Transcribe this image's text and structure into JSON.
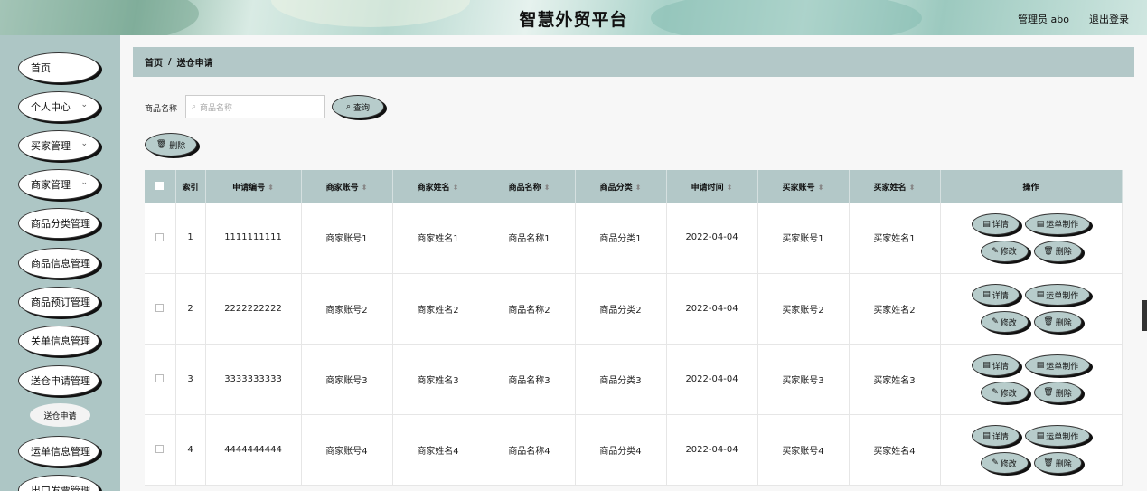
{
  "header": {
    "title": "智慧外贸平台",
    "user_label": "管理员 abo",
    "logout_label": "退出登录"
  },
  "sidebar": {
    "items": [
      {
        "label": "首页",
        "has_chevron": false
      },
      {
        "label": "个人中心",
        "has_chevron": true
      },
      {
        "label": "买家管理",
        "has_chevron": true
      },
      {
        "label": "商家管理",
        "has_chevron": true
      },
      {
        "label": "商品分类管理",
        "has_chevron": false
      },
      {
        "label": "商品信息管理",
        "has_chevron": false
      },
      {
        "label": "商品预订管理",
        "has_chevron": false
      },
      {
        "label": "关单信息管理",
        "has_chevron": false
      },
      {
        "label": "送仓申请管理",
        "has_chevron": false
      },
      {
        "label": "运单信息管理",
        "has_chevron": false
      },
      {
        "label": "出口发票管理",
        "has_chevron": false
      }
    ],
    "submenu": {
      "label": "送仓申请"
    }
  },
  "breadcrumb": {
    "home": "首页",
    "separator": "/",
    "current": "送仓申请"
  },
  "search": {
    "label": "商品名称",
    "placeholder": "商品名称",
    "query_button": "查询",
    "delete_button": "删除"
  },
  "table": {
    "headers": [
      "索引",
      "申请编号",
      "商家账号",
      "商家姓名",
      "商品名称",
      "商品分类",
      "申请时间",
      "买家账号",
      "买家姓名",
      "操作"
    ],
    "rows": [
      {
        "index": "1",
        "apply_no": "1111111111",
        "merchant_acct": "商家账号1",
        "merchant_name": "商家姓名1",
        "product_name": "商品名称1",
        "category": "商品分类1",
        "apply_time": "2022-04-04",
        "buyer_acct": "买家账号1",
        "buyer_name": "买家姓名1"
      },
      {
        "index": "2",
        "apply_no": "2222222222",
        "merchant_acct": "商家账号2",
        "merchant_name": "商家姓名2",
        "product_name": "商品名称2",
        "category": "商品分类2",
        "apply_time": "2022-04-04",
        "buyer_acct": "买家账号2",
        "buyer_name": "买家姓名2"
      },
      {
        "index": "3",
        "apply_no": "3333333333",
        "merchant_acct": "商家账号3",
        "merchant_name": "商家姓名3",
        "product_name": "商品名称3",
        "category": "商品分类3",
        "apply_time": "2022-04-04",
        "buyer_acct": "买家账号3",
        "buyer_name": "买家姓名3"
      },
      {
        "index": "4",
        "apply_no": "4444444444",
        "merchant_acct": "商家账号4",
        "merchant_name": "商家姓名4",
        "product_name": "商品名称4",
        "category": "商品分类4",
        "apply_time": "2022-04-04",
        "buyer_acct": "买家账号4",
        "buyer_name": "买家姓名4"
      }
    ],
    "actions": {
      "detail": "详情",
      "waybill": "运单制作",
      "edit": "修改",
      "delete": "删除"
    }
  },
  "icons": {
    "search": "search-icon",
    "delete": "trash-icon",
    "detail": "document-icon",
    "edit": "pencil-icon",
    "chevron": "chevron-down-icon",
    "cursor": "hand-pointer-icon"
  },
  "colors": {
    "sidebar_bg": "#adc6c5",
    "header_strip": "#b3c8c8",
    "button_bg": "#b7cccb"
  }
}
